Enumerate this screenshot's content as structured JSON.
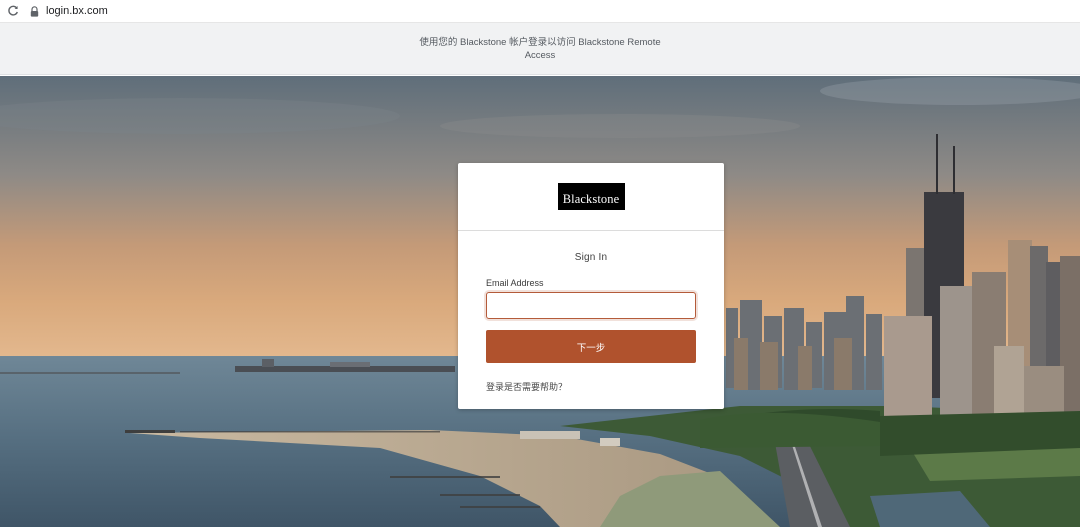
{
  "browser": {
    "url": "login.bx.com",
    "reload_icon": "reload-icon",
    "lock_icon": "lock-icon"
  },
  "banner": {
    "text": "使用您的 Blackstone 帐户登录以访问 Blackstone Remote Access"
  },
  "card": {
    "logo_text": "Blackstone",
    "title": "Sign In",
    "email_label": "Email Address",
    "email_value": "",
    "email_placeholder": "",
    "next_label": "下一步",
    "help_link": "登录是否需要帮助？"
  },
  "colors": {
    "accent": "#b0522d",
    "banner_bg": "#f1f2f3",
    "logo_bg": "#000000"
  }
}
